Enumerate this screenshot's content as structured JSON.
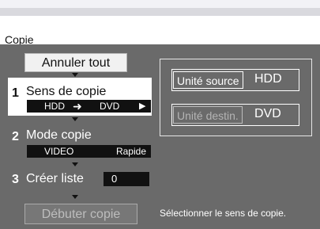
{
  "title": "Copie",
  "buttons": {
    "cancel_all": "Annuler tout",
    "start_copy": "Débuter copie"
  },
  "steps": [
    {
      "number": "1",
      "label": "Sens de copie",
      "value_from": "HDD",
      "value_to": "DVD"
    },
    {
      "number": "2",
      "label": "Mode copie",
      "value_left": "VIDEO",
      "value_right": "Rapide"
    },
    {
      "number": "3",
      "label": "Créer liste",
      "value": "0"
    }
  ],
  "panel": {
    "source_label": "Unité source",
    "source_value": "HDD",
    "dest_label": "Unité destin.",
    "dest_value": "DVD"
  },
  "status_text": "Sélectionner le sens de copie.",
  "icons": {
    "direction_arrow": "arrow-right-icon",
    "next_arrow": "triangle-right-icon"
  }
}
